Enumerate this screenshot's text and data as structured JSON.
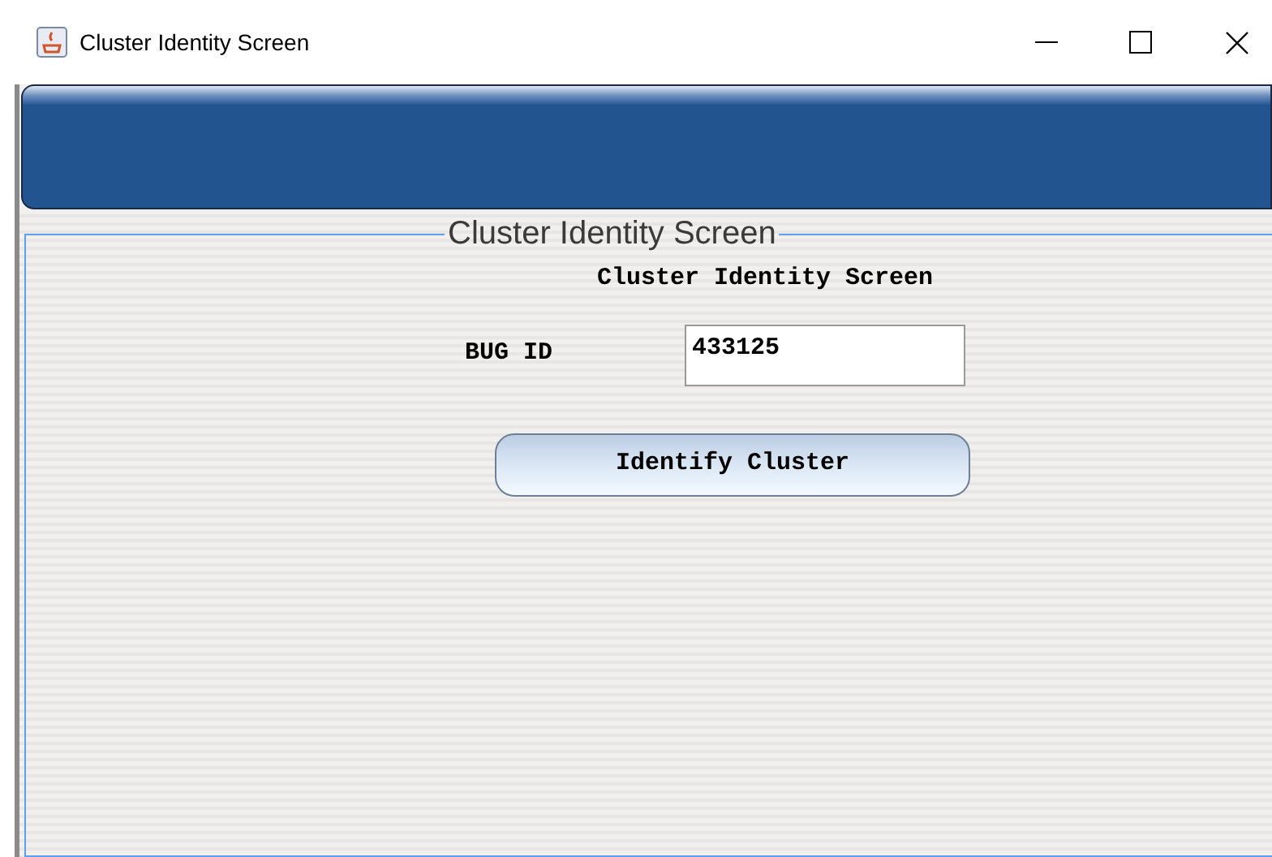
{
  "window": {
    "title": "Cluster Identity Screen"
  },
  "panel": {
    "title": "Cluster Identity Screen",
    "heading": "Cluster Identity Screen",
    "bug_id": {
      "label": "BUG ID",
      "value": "433125"
    },
    "button": "Identify Cluster"
  }
}
